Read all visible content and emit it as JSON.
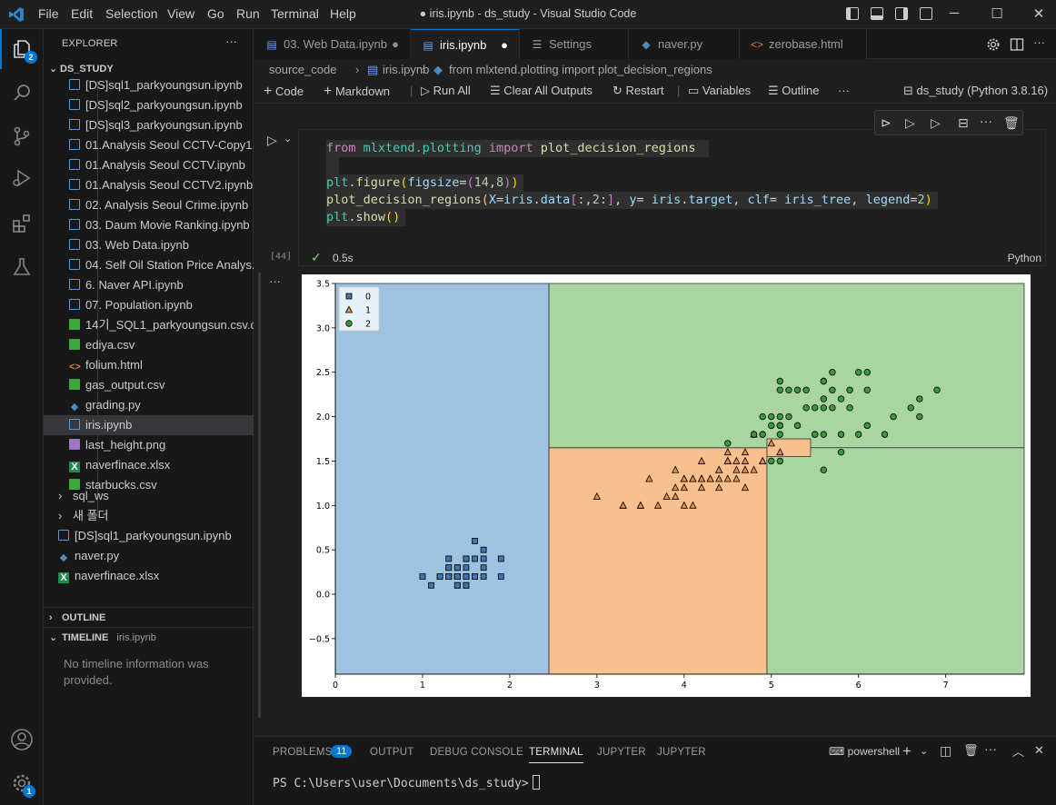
{
  "window": {
    "title": "● iris.ipynb - ds_study - Visual Studio Code",
    "menu": [
      "File",
      "Edit",
      "Selection",
      "View",
      "Go",
      "Run",
      "Terminal",
      "Help"
    ]
  },
  "activity_bar": {
    "explorer_badge": "2",
    "settings_badge": "1"
  },
  "sidebar": {
    "title": "EXPLORER",
    "more": "···",
    "root": "DS_STUDY",
    "files": [
      {
        "name": "[DS]sql1_parkyoungsun.ipynb",
        "type": "nb"
      },
      {
        "name": "[DS]sql2_parkyoungsun.ipynb",
        "type": "nb"
      },
      {
        "name": "[DS]sql3_parkyoungsun.ipynb",
        "type": "nb"
      },
      {
        "name": "01.Analysis Seoul CCTV-Copy1....",
        "type": "nb"
      },
      {
        "name": "01.Analysis Seoul CCTV.ipynb",
        "type": "nb"
      },
      {
        "name": "01.Analysis Seoul CCTV2.ipynb",
        "type": "nb"
      },
      {
        "name": "02. Analysis Seoul Crime.ipynb",
        "type": "nb"
      },
      {
        "name": "03. Daum Movie Ranking.ipynb",
        "type": "nb"
      },
      {
        "name": "03. Web Data.ipynb",
        "type": "nb"
      },
      {
        "name": "04. Self Oil Station Price Analys...",
        "type": "nb"
      },
      {
        "name": "6. Naver API.ipynb",
        "type": "nb"
      },
      {
        "name": "07. Population.ipynb",
        "type": "nb"
      },
      {
        "name": "14기_SQL1_parkyoungsun.csv.c...",
        "type": "csv"
      },
      {
        "name": "ediya.csv",
        "type": "csv"
      },
      {
        "name": "folium.html",
        "type": "html"
      },
      {
        "name": "gas_output.csv",
        "type": "csv"
      },
      {
        "name": "grading.py",
        "type": "py"
      },
      {
        "name": "iris.ipynb",
        "type": "nb",
        "selected": true
      },
      {
        "name": "last_height.png",
        "type": "png"
      },
      {
        "name": "naverfinace.xlsx",
        "type": "xl"
      },
      {
        "name": "starbucks.csv",
        "type": "csv"
      }
    ],
    "folders": [
      "sql_ws",
      "새 폴더"
    ],
    "root_files": [
      {
        "name": "[DS]sql1_parkyoungsun.ipynb",
        "type": "nb"
      },
      {
        "name": "naver.py",
        "type": "py"
      },
      {
        "name": "naverfinace.xlsx",
        "type": "xl"
      }
    ],
    "outline_label": "OUTLINE",
    "timeline_label": "TIMELINE",
    "timeline_file": "iris.ipynb",
    "timeline_empty": "No timeline information was provided."
  },
  "tabs": [
    {
      "label": "03. Web Data.ipynb",
      "icon": "notebook-icon",
      "modified": true
    },
    {
      "label": "iris.ipynb",
      "icon": "notebook-icon",
      "modified": true,
      "active": true
    },
    {
      "label": "Settings",
      "icon": "settings-list-icon"
    },
    {
      "label": "naver.py",
      "icon": "python-icon"
    },
    {
      "label": "zerobase.html",
      "icon": "html-icon"
    }
  ],
  "breadcrumb": {
    "folder": "source_code",
    "file": "iris.ipynb",
    "cell": "from mlxtend.plotting import plot_decision_regions"
  },
  "notebook_toolbar": {
    "code": "Code",
    "markdown": "Markdown",
    "run_all": "Run All",
    "clear_outputs": "Clear All Outputs",
    "restart": "Restart",
    "variables": "Variables",
    "outline": "Outline",
    "more": "···",
    "kernel": "ds_study (Python 3.8.16)"
  },
  "cell": {
    "exec_count": "[44]",
    "duration": "0.5s",
    "language": "Python",
    "output_more": "···"
  },
  "chart_data": {
    "type": "scatter",
    "title": "",
    "xlabel": "",
    "ylabel": "",
    "xlim": [
      0,
      7.9
    ],
    "ylim": [
      -0.9,
      3.5
    ],
    "xticks": [
      "0",
      "1",
      "2",
      "3",
      "4",
      "5",
      "6",
      "7"
    ],
    "yticks": [
      "−0.5",
      "0.0",
      "0.5",
      "1.0",
      "1.5",
      "2.0",
      "2.5",
      "3.0",
      "3.5"
    ],
    "legend_position": "top-left",
    "regions": [
      {
        "class": "0",
        "x0": 0,
        "x1": 2.45,
        "y0": -0.9,
        "y1": 3.5,
        "color": "#9ec2e0"
      },
      {
        "class": "1",
        "x0": 2.45,
        "x1": 4.95,
        "y0": -0.9,
        "y1": 1.65,
        "color": "#f8c08e"
      },
      {
        "class": "2",
        "x0": 2.45,
        "x1": 7.9,
        "y0": 1.65,
        "y1": 3.5,
        "color": "#a8d5a0"
      },
      {
        "class": "2",
        "x0": 4.95,
        "x1": 7.9,
        "y0": -0.9,
        "y1": 1.65,
        "color": "#a8d5a0"
      },
      {
        "class": "1",
        "x0": 4.95,
        "x1": 5.45,
        "y0": 1.55,
        "y1": 1.75,
        "color": "#f8c08e"
      }
    ],
    "series": [
      {
        "name": "0",
        "marker": "square",
        "color": "#3c78b4",
        "x": [
          1.4,
          1.4,
          1.3,
          1.5,
          1.4,
          1.7,
          1.4,
          1.5,
          1.4,
          1.5,
          1.5,
          1.6,
          1.4,
          1.1,
          1.2,
          1.5,
          1.3,
          1.4,
          1.7,
          1.5,
          1.7,
          1.5,
          1.0,
          1.7,
          1.9,
          1.6,
          1.6,
          1.5,
          1.4,
          1.6,
          1.6,
          1.5,
          1.5,
          1.4,
          1.5,
          1.2,
          1.3,
          1.4,
          1.3,
          1.5,
          1.3,
          1.3,
          1.3,
          1.6,
          1.9,
          1.4,
          1.6,
          1.4,
          1.5,
          1.4
        ],
        "y": [
          0.2,
          0.2,
          0.2,
          0.2,
          0.2,
          0.4,
          0.3,
          0.2,
          0.2,
          0.1,
          0.2,
          0.2,
          0.1,
          0.1,
          0.2,
          0.4,
          0.4,
          0.3,
          0.3,
          0.3,
          0.2,
          0.4,
          0.2,
          0.5,
          0.2,
          0.2,
          0.4,
          0.2,
          0.2,
          0.2,
          0.2,
          0.4,
          0.1,
          0.2,
          0.2,
          0.2,
          0.2,
          0.1,
          0.2,
          0.2,
          0.3,
          0.3,
          0.2,
          0.6,
          0.4,
          0.3,
          0.2,
          0.2,
          0.2,
          0.2
        ]
      },
      {
        "name": "1",
        "marker": "triangle",
        "color": "#e69138",
        "x": [
          4.7,
          4.5,
          4.9,
          4.0,
          4.6,
          4.5,
          4.7,
          3.3,
          4.6,
          3.9,
          3.5,
          4.2,
          4.0,
          4.7,
          3.6,
          4.4,
          4.5,
          4.1,
          4.5,
          3.9,
          4.8,
          4.0,
          4.9,
          4.7,
          4.3,
          4.4,
          4.8,
          5.0,
          4.5,
          3.5,
          3.8,
          3.7,
          3.9,
          5.1,
          4.5,
          4.5,
          4.7,
          4.4,
          4.1,
          4.0,
          4.4,
          4.6,
          4.0,
          3.3,
          4.2,
          4.2,
          4.2,
          4.3,
          3.0,
          4.1
        ],
        "y": [
          1.4,
          1.5,
          1.5,
          1.3,
          1.5,
          1.3,
          1.6,
          1.0,
          1.3,
          1.4,
          1.0,
          1.5,
          1.0,
          1.4,
          1.3,
          1.4,
          1.5,
          1.0,
          1.5,
          1.1,
          1.8,
          1.3,
          1.5,
          1.2,
          1.3,
          1.4,
          1.4,
          1.7,
          1.5,
          1.0,
          1.1,
          1.0,
          1.2,
          1.6,
          1.5,
          1.6,
          1.5,
          1.3,
          1.3,
          1.3,
          1.2,
          1.4,
          1.2,
          1.0,
          1.3,
          1.2,
          1.3,
          1.3,
          1.1,
          1.3
        ]
      },
      {
        "name": "2",
        "marker": "circle",
        "color": "#3a9a3a",
        "x": [
          6.0,
          5.1,
          5.9,
          5.6,
          5.8,
          6.6,
          4.5,
          6.3,
          5.8,
          6.1,
          5.1,
          5.3,
          5.5,
          5.0,
          5.1,
          5.3,
          5.5,
          6.7,
          6.9,
          5.0,
          5.7,
          4.9,
          6.7,
          4.9,
          5.7,
          6.0,
          4.8,
          4.9,
          5.6,
          5.8,
          6.1,
          6.4,
          5.6,
          5.1,
          5.6,
          6.1,
          5.6,
          5.5,
          4.8,
          5.4,
          5.6,
          5.1,
          5.1,
          5.9,
          5.7,
          5.2,
          5.0,
          5.2,
          5.4,
          5.1
        ],
        "y": [
          2.5,
          1.9,
          2.1,
          1.8,
          2.2,
          2.1,
          1.7,
          1.8,
          1.8,
          2.5,
          2.0,
          1.9,
          2.1,
          2.0,
          2.4,
          2.3,
          1.8,
          2.2,
          2.3,
          1.5,
          2.3,
          2.0,
          2.0,
          1.8,
          2.1,
          1.8,
          1.8,
          1.8,
          2.1,
          1.6,
          1.9,
          2.0,
          2.2,
          1.5,
          1.4,
          2.3,
          2.4,
          1.8,
          1.8,
          2.1,
          2.4,
          2.3,
          1.9,
          2.3,
          2.5,
          2.3,
          1.9,
          2.0,
          2.3,
          1.8
        ]
      }
    ]
  },
  "panel": {
    "tabs": [
      "PROBLEMS",
      "OUTPUT",
      "DEBUG CONSOLE",
      "TERMINAL",
      "JUPYTER",
      "JUPYTER"
    ],
    "problems_count": "11",
    "shell": "powershell",
    "prompt": "PS C:\\Users\\user\\Documents\\ds_study>"
  }
}
